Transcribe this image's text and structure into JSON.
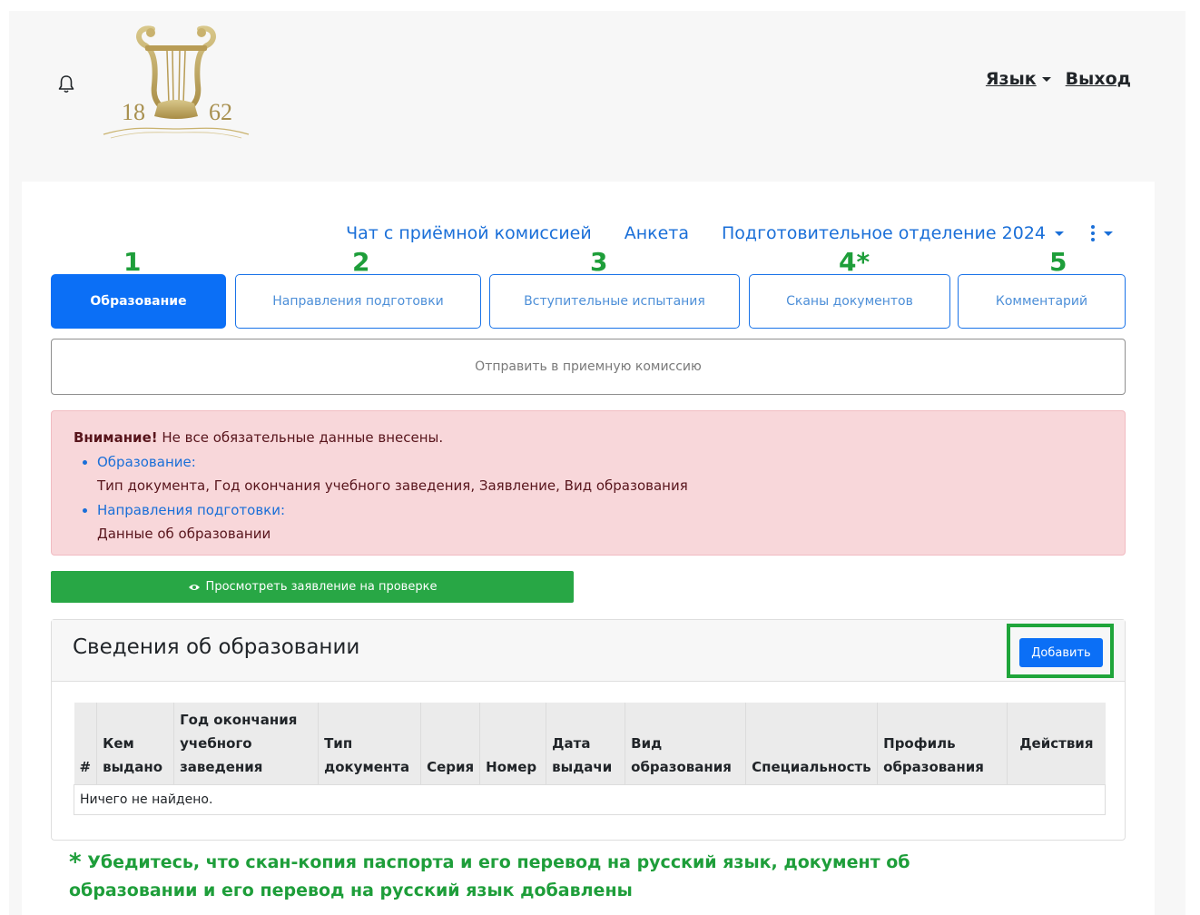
{
  "header": {
    "language_label": "Язык",
    "logout_label": "Выход",
    "logo_text_left": "18",
    "logo_text_right": "62"
  },
  "nav": {
    "chat_label": "Чат с приёмной комиссией",
    "questionnaire_label": "Анкета",
    "department_label": "Подготовительное отделение 2024"
  },
  "steps": [
    {
      "number": "1",
      "label": "Образование",
      "active": true
    },
    {
      "number": "2",
      "label": "Направления подготовки",
      "active": false
    },
    {
      "number": "3",
      "label": "Вступительные испытания",
      "active": false
    },
    {
      "number": "4*",
      "label": "Сканы документов",
      "active": false
    },
    {
      "number": "5",
      "label": "Комментарий",
      "active": false
    }
  ],
  "send_button_label": "Отправить в приемную комиссию",
  "alert": {
    "title": "Внимание!",
    "message": "Не все обязательные данные внесены.",
    "items": [
      {
        "link": "Образование:",
        "detail": "Тип документа, Год окончания учебного заведения, Заявление, Вид образования"
      },
      {
        "link": "Направления подготовки:",
        "detail": "Данные об образовании"
      }
    ]
  },
  "view_button_label": "Просмотреть заявление на проверке",
  "card": {
    "title": "Сведения об образовании",
    "add_button_label": "Добавить",
    "columns": [
      "#",
      "Кем выдано",
      "Год окончания учебного заведения",
      "Тип документа",
      "Серия",
      "Номер",
      "Дата выдачи",
      "Вид образования",
      "Специальность",
      "Профиль образования",
      "Действия"
    ],
    "empty_text": "Ничего не найдено."
  },
  "note": {
    "star": "*",
    "text": "Убедитесь, что скан-копия паспорта и его перевод на русский язык, документ об образовании и его перевод на русский язык добавлены"
  },
  "colors": {
    "primary": "#0b6ff6",
    "success": "#28a745",
    "step_number": "#1e9e3a",
    "alert_bg": "#f8d7da",
    "link": "#1a6fd8"
  }
}
